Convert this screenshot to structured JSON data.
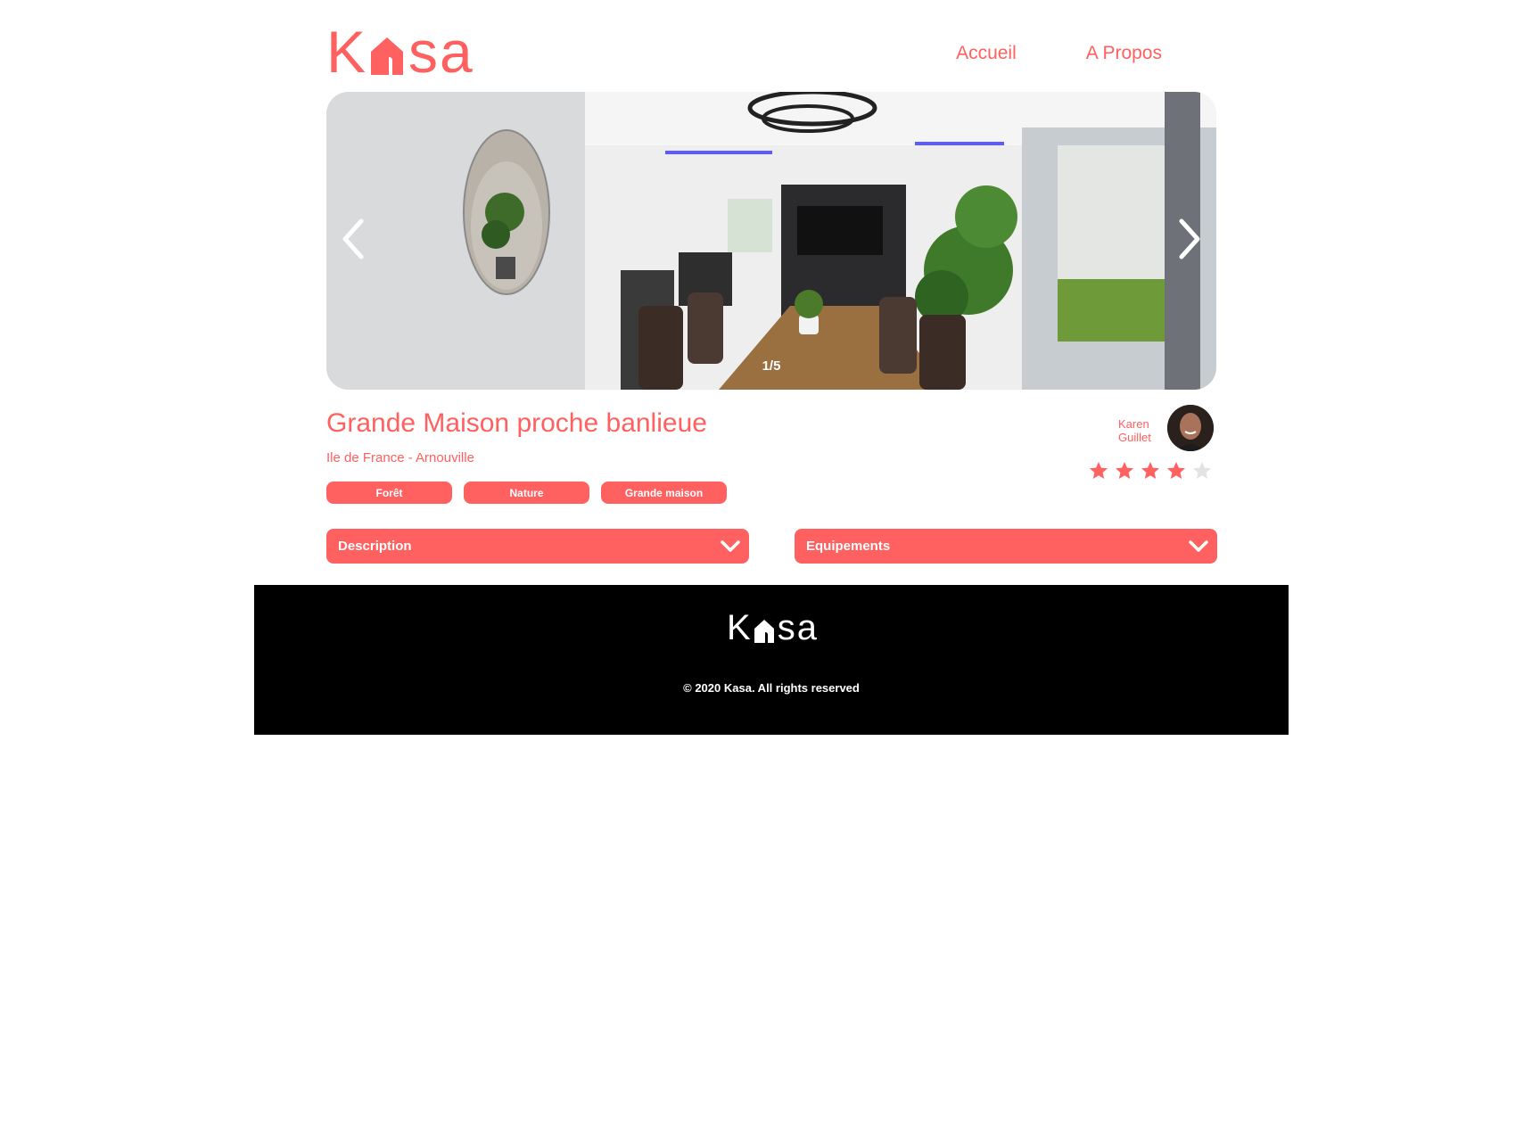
{
  "header": {
    "logo": {
      "k": "K",
      "rest": "sa"
    },
    "nav": [
      {
        "label": "Accueil"
      },
      {
        "label": "A Propos"
      }
    ]
  },
  "carousel": {
    "counter": "1/5",
    "prev_icon": "chevron-left-icon",
    "next_icon": "chevron-right-icon"
  },
  "listing": {
    "title": "Grande Maison proche banlieue",
    "location": "Ile de France - Arnouville",
    "tags": [
      "Forêt",
      "Nature",
      "Grande maison"
    ],
    "host": {
      "first_name": "Karen",
      "last_name": "Guillet"
    },
    "rating": 4,
    "rating_max": 5
  },
  "collapses": {
    "description": "Description",
    "equipments": "Equipements"
  },
  "footer": {
    "logo": {
      "k": "K",
      "rest": "sa"
    },
    "copyright": "© 2020 Kasa. All rights reserved"
  },
  "colors": {
    "accent": "#ff6060",
    "footer_bg": "#000000",
    "star_off": "#e3e3e3"
  }
}
